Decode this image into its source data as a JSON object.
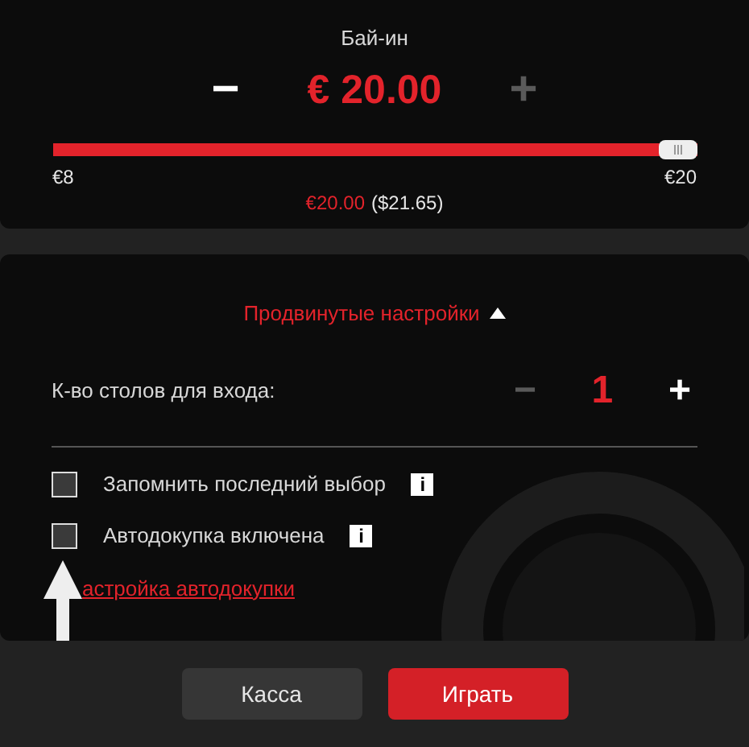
{
  "buyin": {
    "title": "Бай-ин",
    "minus": {
      "label": "−",
      "disabled": false
    },
    "amount": "€ 20.00",
    "plus": {
      "label": "+",
      "disabled": true
    },
    "slider": {
      "level": 1.0
    },
    "min_label": "€8",
    "max_label": "€20",
    "summary_amount": "€20.00",
    "summary_converted": "($21.65)"
  },
  "advanced": {
    "toggle": "Продвинутые настройки",
    "expanded": true,
    "tables": {
      "label": "К-во столов для входа:",
      "minus": {
        "label": "−",
        "disabled": true
      },
      "value": "1",
      "plus": {
        "label": "+",
        "disabled": false
      }
    },
    "options": [
      {
        "label": "Запомнить последний выбор",
        "checked": false,
        "info": "i"
      },
      {
        "label": "Автодокупка включена",
        "checked": false,
        "info": "i"
      }
    ],
    "link": "астройка автодокупки"
  },
  "buttons": [
    {
      "label": "Касса",
      "kind": "secondary"
    },
    {
      "label": "Играть",
      "kind": "primary"
    }
  ]
}
